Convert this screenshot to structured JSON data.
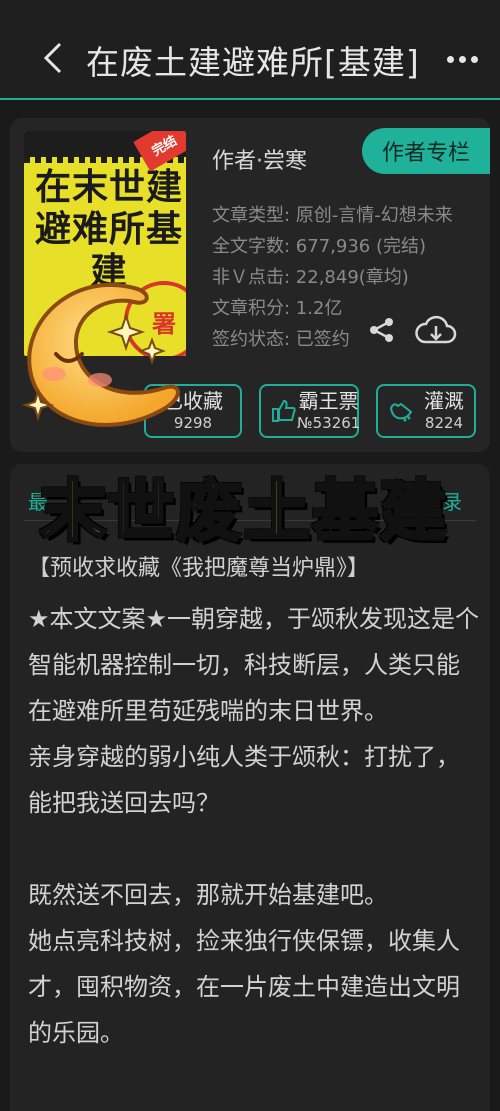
{
  "header": {
    "title": "在废土建避难所[基建]",
    "back_icon": "chevron-left-icon",
    "more_icon": "more-dots-icon"
  },
  "book": {
    "cover": {
      "title": "在末世建避难所基建",
      "badge": "完结",
      "stamp": "署"
    },
    "author": "作者·尝寒",
    "author_button": "作者专栏",
    "meta": [
      "文章类型: 原创-言情-幻想未来",
      "全文字数: 677,936 (完结)",
      "非Ｖ点击: 22,849(章均)",
      "文章积分: 1.2亿",
      "签约状态: 已签约"
    ],
    "share_icon": "share-icon",
    "download_icon": "cloud-download-icon"
  },
  "actions": [
    {
      "label": "已收藏",
      "count": "9298",
      "icon": "star-icon"
    },
    {
      "label": "霸王票",
      "count": "№53261",
      "icon": "thumbs-up-icon"
    },
    {
      "label": "灌溉",
      "count": "8224",
      "icon": "watering-can-icon"
    }
  ],
  "overlay_title": "末世废土基建",
  "tabs": {
    "left": "最",
    "right": "录"
  },
  "content": {
    "promo": "【预收求收藏《我把魔尊当炉鼎》】",
    "paragraphs": [
      "★本文文案★一朝穿越，于颂秋发现这是个智能机器控制一切，科技断层，人类只能在避难所里苟延残喘的末日世界。",
      "亲身穿越的弱小纯人类于颂秋：打扰了，能把我送回去吗？",
      "",
      "既然送不回去，那就开始基建吧。",
      "她点亮科技树，捡来独行侠保镖，收集人才，囤积物资，在一片废土中建造出文明的乐园。"
    ]
  },
  "colors": {
    "accent": "#1fae9b",
    "background": "#1a1a1a",
    "overlay_text": "#f4ea1d"
  }
}
